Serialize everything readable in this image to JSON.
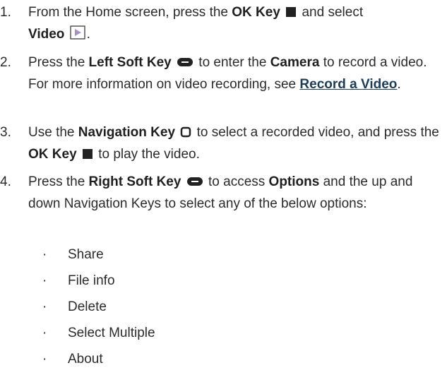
{
  "steps": [
    {
      "num": "1.",
      "t1": "From the Home screen, press the ",
      "b1": "OK Key",
      "t2": " and select ",
      "b2": "Video",
      "t3": "."
    },
    {
      "num": "2.",
      "t1": "Press the ",
      "b1": "Left Soft Key",
      "t2": " to enter the ",
      "b2": "Camera",
      "t3": " to record a video. For more information on video recording, see ",
      "link": "Record a Video",
      "t4": "."
    },
    {
      "num": "3.",
      "t1": "Use the ",
      "b1": "Navigation Key",
      "t2": " to select a recorded video, and press the ",
      "b2": "OK Key",
      "t3": " to play the video."
    },
    {
      "num": "4.",
      "t1": "Press the ",
      "b1": "Right Soft Key",
      "t2": " to access ",
      "b2": "Options",
      "t3": " and the up and down Navigation Keys to select any of the below options:"
    }
  ],
  "bullet_char": "·",
  "options": [
    "Share",
    "File info",
    "Delete",
    "Select Multiple",
    "About"
  ],
  "colors": {
    "text": "#2b2b2b",
    "link": "#1c3d5a",
    "video_icon_fill": "#a78fc4"
  },
  "icons": [
    "ok-key-icon",
    "video-app-icon",
    "soft-key-icon",
    "navigation-key-icon"
  ]
}
